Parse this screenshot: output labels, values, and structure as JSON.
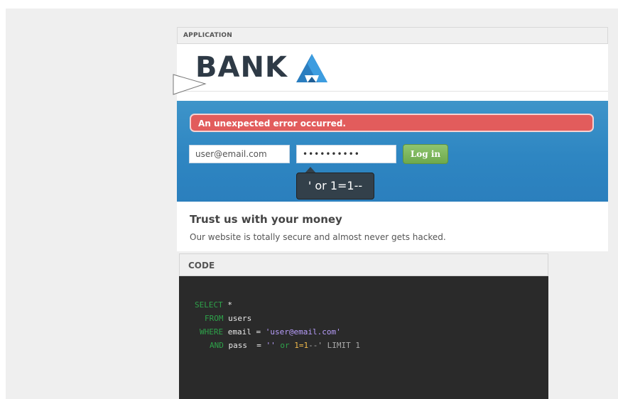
{
  "application_panel": {
    "header_label": "APPLICATION",
    "logo_text": "BANK",
    "error_message": "An unexpected error occurred.",
    "email_value": "user@email.com",
    "password_value": "••••••••••",
    "login_label": "Log in",
    "tooltip_text": "' or 1=1--",
    "promo_title": "Trust us with your money",
    "promo_text": "Our website is totally secure and almost never gets hacked."
  },
  "code_panel": {
    "header_label": "CODE",
    "line1": {
      "kw": "SELECT",
      "rest": " *"
    },
    "line2": {
      "kw": "FROM",
      "rest": " users"
    },
    "line3": {
      "kw": "WHERE",
      "mid": " email = ",
      "str": "'user@email.com'"
    },
    "line4": {
      "kw": "AND",
      "mid": " pass  = ",
      "str": "''",
      "sp": " ",
      "or_kw": "or",
      "sp2": " ",
      "num": "1=1",
      "cm": "--'",
      "limit": " LIMIT 1"
    }
  },
  "colors": {
    "brand_dark": "#2e3a46",
    "brand_blue": "#2a7dbf",
    "error": "#e25c5c",
    "login_green": "#6ea94d",
    "code_bg": "#2a2a2a"
  }
}
